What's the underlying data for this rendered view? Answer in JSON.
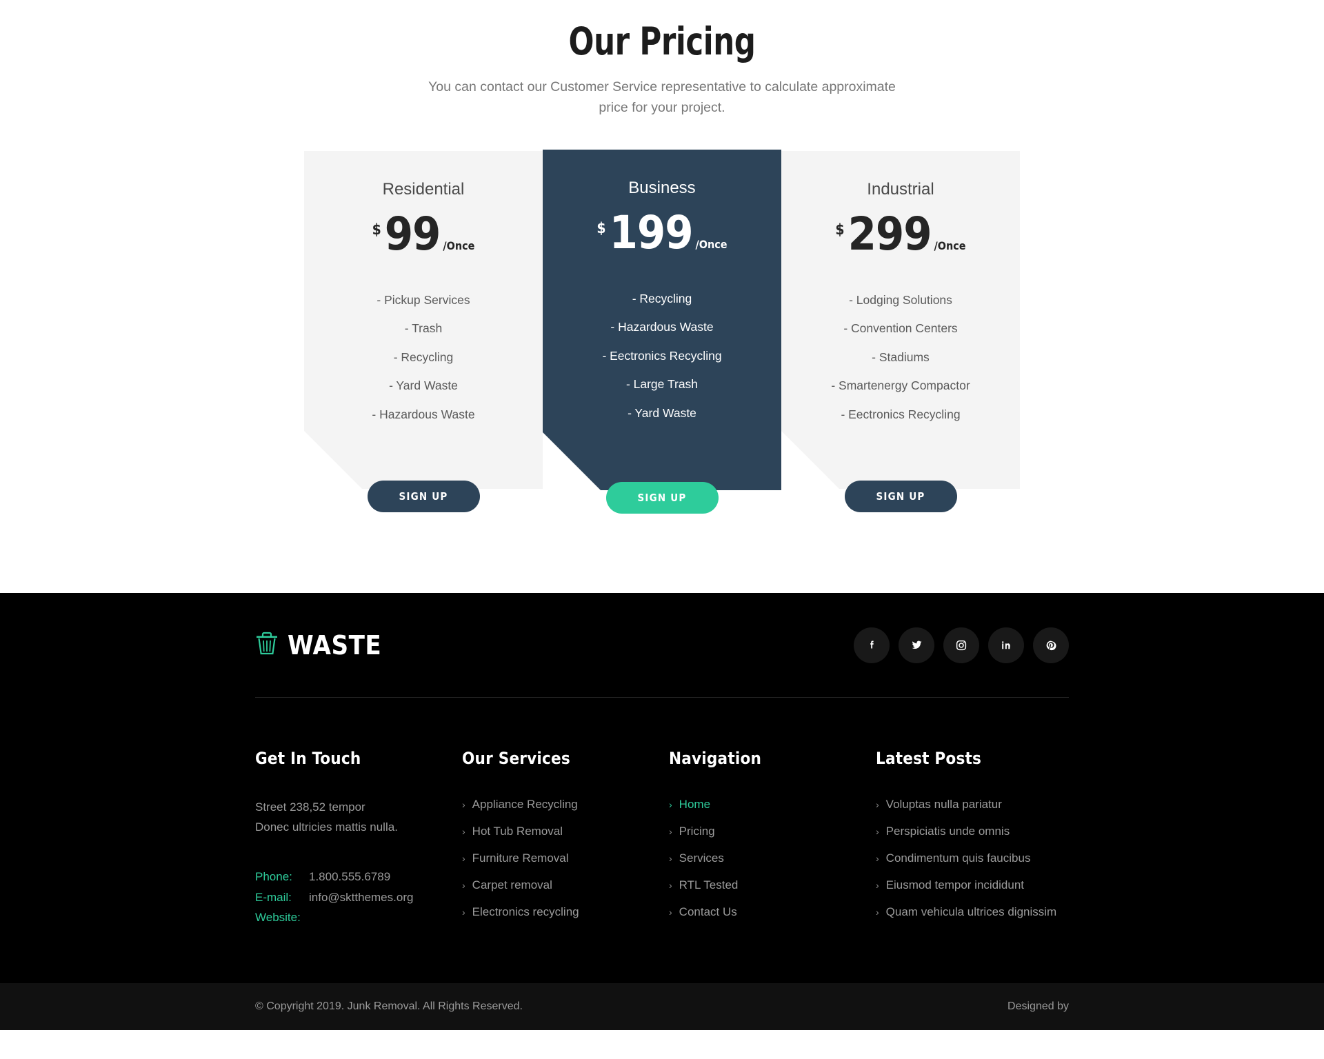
{
  "pricing": {
    "heading": "Our Pricing",
    "subtitle": "You can contact our Customer Service representative to calculate approximate price for your project.",
    "accent_color": "#2ecc9b",
    "dark_color": "#2d4459",
    "plans": [
      {
        "name": "Residential",
        "currency": "$",
        "amount": "99",
        "period": "/Once",
        "features": [
          "- Pickup Services",
          "- Trash",
          "- Recycling",
          "- Yard Waste",
          "- Hazardous Waste"
        ],
        "cta": "SIGN UP"
      },
      {
        "name": "Business",
        "currency": "$",
        "amount": "199",
        "period": "/Once",
        "features": [
          "- Recycling",
          "- Hazardous Waste",
          "- Eectronics Recycling",
          "- Large Trash",
          "- Yard Waste"
        ],
        "cta": "SIGN UP"
      },
      {
        "name": "Industrial",
        "currency": "$",
        "amount": "299",
        "period": "/Once",
        "features": [
          "- Lodging Solutions",
          "- Convention Centers",
          "- Stadiums",
          "- Smartenergy Compactor",
          "- Eectronics Recycling"
        ],
        "cta": "SIGN UP"
      }
    ]
  },
  "footer": {
    "brand": {
      "name": "WASTE",
      "icon": "trash-can-icon",
      "icon_color": "#2ecc9b"
    },
    "socials": [
      {
        "name": "facebook-icon",
        "label": "Facebook"
      },
      {
        "name": "twitter-icon",
        "label": "Twitter"
      },
      {
        "name": "instagram-icon",
        "label": "Instagram"
      },
      {
        "name": "linkedin-icon",
        "label": "LinkedIn"
      },
      {
        "name": "pinterest-icon",
        "label": "Pinterest"
      }
    ],
    "get_in_touch": {
      "title": "Get In Touch",
      "address_line_1": "Street 238,52 tempor",
      "address_line_2": "Donec ultricies mattis nulla.",
      "phone_label": "Phone:",
      "phone_value": "1.800.555.6789",
      "email_label": "E-mail:",
      "email_value": "info@sktthemes.org",
      "website_label": "Website:",
      "website_value": ""
    },
    "our_services": {
      "title": "Our Services",
      "items": [
        "Appliance Recycling",
        "Hot Tub Removal",
        "Furniture Removal",
        "Carpet removal",
        "Electronics recycling"
      ]
    },
    "navigation": {
      "title": "Navigation",
      "items": [
        {
          "label": "Home",
          "active": true
        },
        {
          "label": "Pricing",
          "active": false
        },
        {
          "label": "Services",
          "active": false
        },
        {
          "label": "RTL Tested",
          "active": false
        },
        {
          "label": "Contact Us",
          "active": false
        }
      ]
    },
    "latest_posts": {
      "title": "Latest Posts",
      "items": [
        "Voluptas nulla pariatur",
        "Perspiciatis unde omnis",
        "Condimentum quis faucibus",
        "Eiusmod tempor incididunt",
        "Quam vehicula ultrices dignissim"
      ]
    },
    "bottom": {
      "copyright": "© Copyright 2019. Junk Removal. All Rights Reserved.",
      "designed_by": "Designed by"
    }
  }
}
